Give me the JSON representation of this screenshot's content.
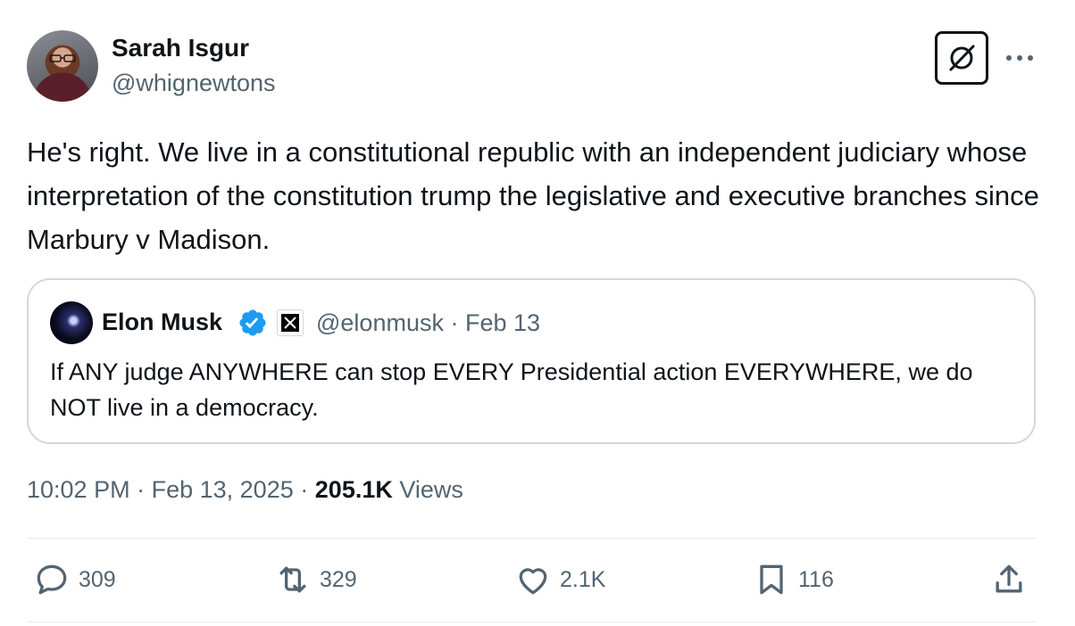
{
  "author": {
    "name": "Sarah Isgur",
    "handle": "@whignewtons"
  },
  "tweet": {
    "text": "He's right. We live in a constitutional republic with an independent judiciary whose interpretation of the constitution trump the legislative and executive branches since Marbury v Madison."
  },
  "quoted": {
    "name": "Elon Musk",
    "handle": "@elonmusk",
    "separator": "·",
    "date": "Feb 13",
    "text": "If ANY judge ANYWHERE can stop EVERY Presidential action EVERYWHERE, we do NOT live in a democracy."
  },
  "meta": {
    "time": "10:02 PM",
    "sep1": "·",
    "date": "Feb 13, 2025",
    "sep2": "·",
    "views_count": "205.1K",
    "views_label": "Views"
  },
  "actions": {
    "replies": "309",
    "reposts": "329",
    "likes": "2.1K",
    "bookmarks": "116"
  },
  "icons": {
    "grok": "grok-icon",
    "more": "more-icon",
    "verified": "verified-badge-icon",
    "x_affiliate": "x-logo-icon",
    "reply": "reply-icon",
    "repost": "repost-icon",
    "like": "heart-icon",
    "bookmark": "bookmark-icon",
    "share": "share-icon"
  },
  "colors": {
    "text": "#0f1419",
    "secondary": "#536471",
    "verified": "#1d9bf0",
    "border": "#cfd9de"
  }
}
